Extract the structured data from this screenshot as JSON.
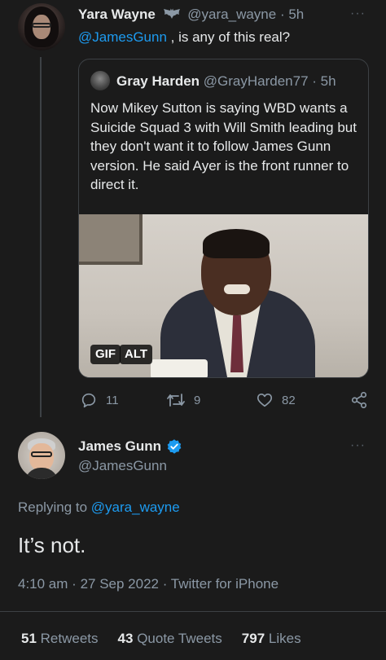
{
  "reply_tweet": {
    "author_name": "Yara Wayne",
    "author_handle": "@yara_wayne",
    "time": "5h",
    "text_mention": "@JamesGunn",
    "text_rest": " , is any of this real?",
    "more_label": "···",
    "quoted": {
      "author_name": "Gray Harden",
      "author_handle": "@GrayHarden77",
      "time": "5h",
      "text": "Now Mikey Sutton is saying WBD wants a Suicide Squad 3 with Will Smith leading but they don't want it to follow James Gunn version.  He said Ayer is the front runner to direct it.",
      "media_badges": [
        "GIF",
        "ALT"
      ]
    },
    "actions": {
      "replies": "11",
      "retweets": "9",
      "likes": "82"
    }
  },
  "main_tweet": {
    "author_name": "James Gunn",
    "author_handle": "@JamesGunn",
    "more_label": "···",
    "replying_prefix": "Replying to ",
    "replying_handle": "@yara_wayne",
    "text": "It’s not.",
    "time": "4:10 am",
    "date": "27 Sep 2022",
    "source": "Twitter for iPhone",
    "stats": {
      "retweets_count": "51",
      "retweets_label": "Retweets",
      "quotes_count": "43",
      "quotes_label": "Quote Tweets",
      "likes_count": "797",
      "likes_label": "Likes"
    }
  },
  "colors": {
    "background": "#1b1b1b",
    "text": "#e7e9ea",
    "muted": "#8b98a5",
    "link": "#1d9bf0",
    "verified": "#1d9bf0",
    "border": "#3d4145"
  },
  "icons": [
    "batman-emoji-icon",
    "reply-icon",
    "retweet-icon",
    "like-icon",
    "share-icon",
    "verified-badge-icon",
    "more-icon"
  ]
}
